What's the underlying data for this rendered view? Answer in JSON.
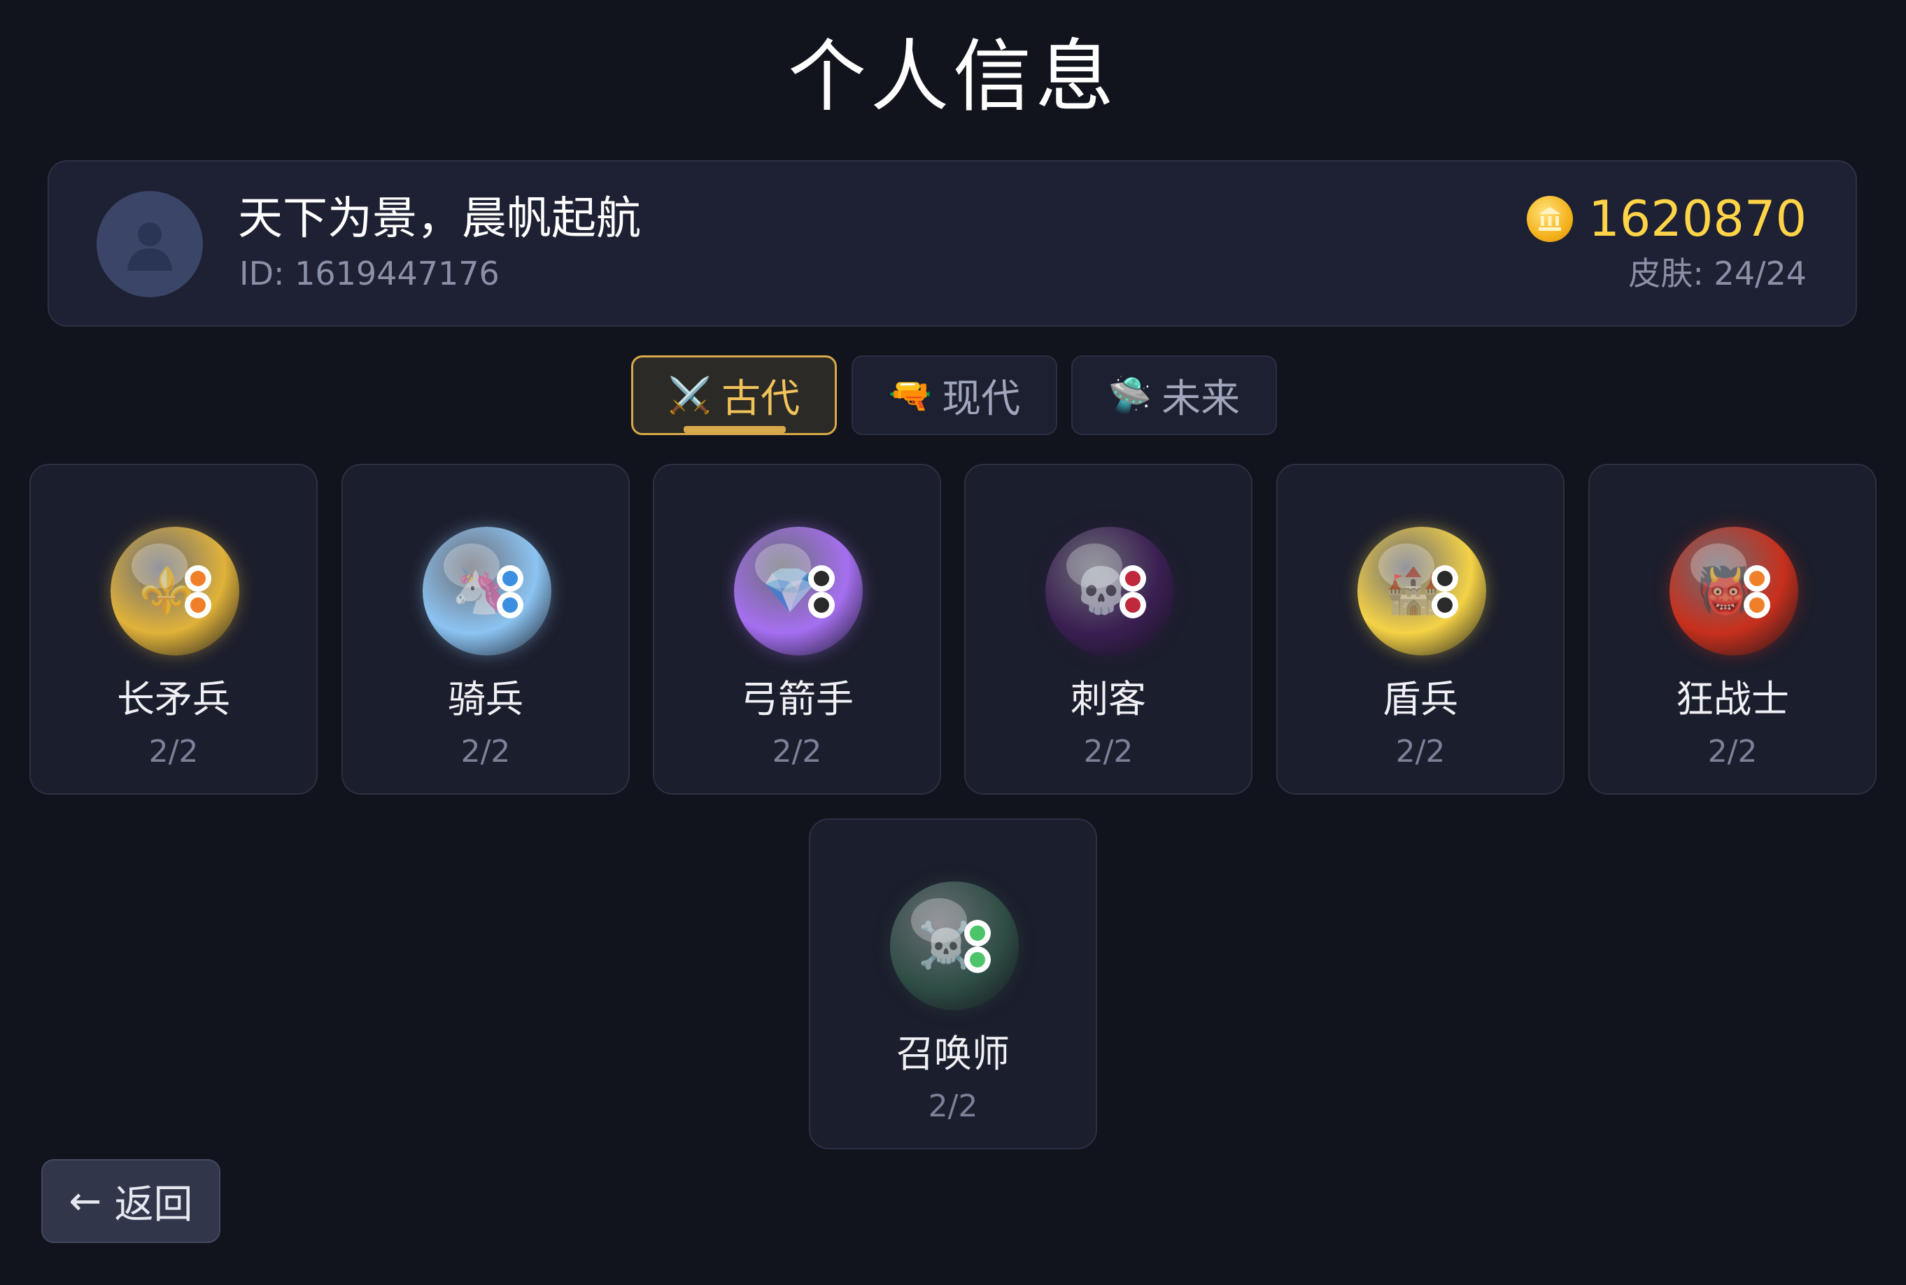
{
  "page_title": "个人信息",
  "player": {
    "name": "天下为景，晨帆起航",
    "id_text": "ID: 1619447176",
    "coins": "1620870",
    "coin_icon": "coin-icon",
    "skins_text": "皮肤: 24/24",
    "avatar_icon": "person-silhouette-icon"
  },
  "tabs": [
    {
      "label": "古代",
      "emoji": "⚔️",
      "active": true
    },
    {
      "label": "现代",
      "emoji": "🔫",
      "active": false
    },
    {
      "label": "未来",
      "emoji": "🛸",
      "active": false
    }
  ],
  "units": [
    {
      "name": "长矛兵",
      "count": "2/2",
      "emoji": "⚜️",
      "color": "#e0b23a",
      "eye_color": "#f07f2a"
    },
    {
      "name": "骑兵",
      "count": "2/2",
      "emoji": "🦄",
      "color": "#8cc4f2",
      "eye_color": "#3b8ee0"
    },
    {
      "name": "弓箭手",
      "count": "2/2",
      "emoji": "💎",
      "color": "#a56ff0",
      "eye_color": "#2a2a2a"
    },
    {
      "name": "刺客",
      "count": "2/2",
      "emoji": "💀",
      "color": "#3a1f52",
      "eye_color": "#c0283c"
    },
    {
      "name": "盾兵",
      "count": "2/2",
      "emoji": "🏰",
      "color": "#f5d246",
      "eye_color": "#2a2a2a"
    },
    {
      "name": "狂战士",
      "count": "2/2",
      "emoji": "👹",
      "color": "#c8301c",
      "eye_color": "#f07f2a"
    },
    {
      "name": "召唤师",
      "count": "2/2",
      "emoji": "☠️",
      "color": "#2f4e46",
      "eye_color": "#4ec46a"
    }
  ],
  "back_button": {
    "label": "返回",
    "arrow": "←"
  }
}
